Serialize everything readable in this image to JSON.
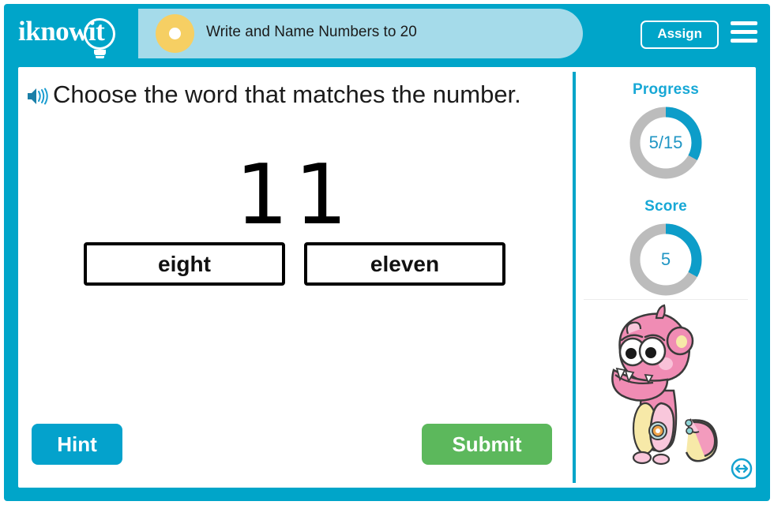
{
  "brand": {
    "logo_text": "iknowit",
    "logo_icon": "lightbulb-icon",
    "header_color": "#00a5c9",
    "title_band_color": "#a5dbea",
    "badge_color": "#f6cf63"
  },
  "header": {
    "lesson_title": "Write and Name Numbers to 20",
    "assign_label": "Assign",
    "menu_icon": "hamburger-menu-icon",
    "badge_icon": "lesson-badge-icon"
  },
  "question": {
    "audio_icon": "speaker-icon",
    "prompt": "Choose the word that matches the number.",
    "numeral": "11",
    "choices": [
      {
        "label": "eight",
        "selected": false
      },
      {
        "label": "eleven",
        "selected": false
      }
    ]
  },
  "actions": {
    "hint_label": "Hint",
    "hint_color": "#04a2cc",
    "submit_label": "Submit",
    "submit_color": "#5cb85c"
  },
  "sidebar": {
    "progress": {
      "label": "Progress",
      "value_text": "5/15",
      "current": 5,
      "total": 15,
      "percent": 33,
      "arc_color": "#0d9dc9",
      "track_color": "#bcbcbc"
    },
    "score": {
      "label": "Score",
      "value_text": "5",
      "current": 5,
      "percent": 33,
      "arc_color": "#0d9dc9",
      "track_color": "#bcbcbc"
    },
    "mascot_icon": "pink-monster-mascot",
    "resize_icon": "resize-horizontal-icon"
  }
}
